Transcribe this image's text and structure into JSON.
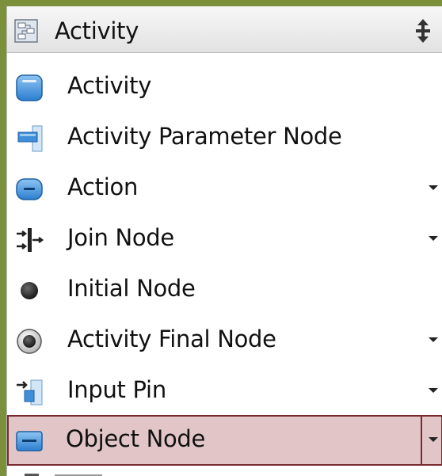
{
  "palette": {
    "title": "Activity",
    "items": [
      {
        "label": "Activity",
        "icon": "activity-icon",
        "has_more": false,
        "selected": false
      },
      {
        "label": "Activity Parameter Node",
        "icon": "activity-parameter-node-icon",
        "has_more": false,
        "selected": false
      },
      {
        "label": "Action",
        "icon": "action-icon",
        "has_more": true,
        "selected": false
      },
      {
        "label": "Join Node",
        "icon": "join-node-icon",
        "has_more": true,
        "selected": false
      },
      {
        "label": "Initial Node",
        "icon": "initial-node-icon",
        "has_more": false,
        "selected": false
      },
      {
        "label": "Activity Final Node",
        "icon": "activity-final-node-icon",
        "has_more": true,
        "selected": false
      },
      {
        "label": "Input Pin",
        "icon": "input-pin-icon",
        "has_more": true,
        "selected": false
      },
      {
        "label": "Object Node",
        "icon": "object-node-icon",
        "has_more": true,
        "selected": true
      }
    ]
  },
  "colors": {
    "background": "#7c8f3a",
    "selection_fill": "#e2c6c7",
    "selection_border": "#7a2a2e",
    "icon_blue": "#3f8fd8"
  }
}
